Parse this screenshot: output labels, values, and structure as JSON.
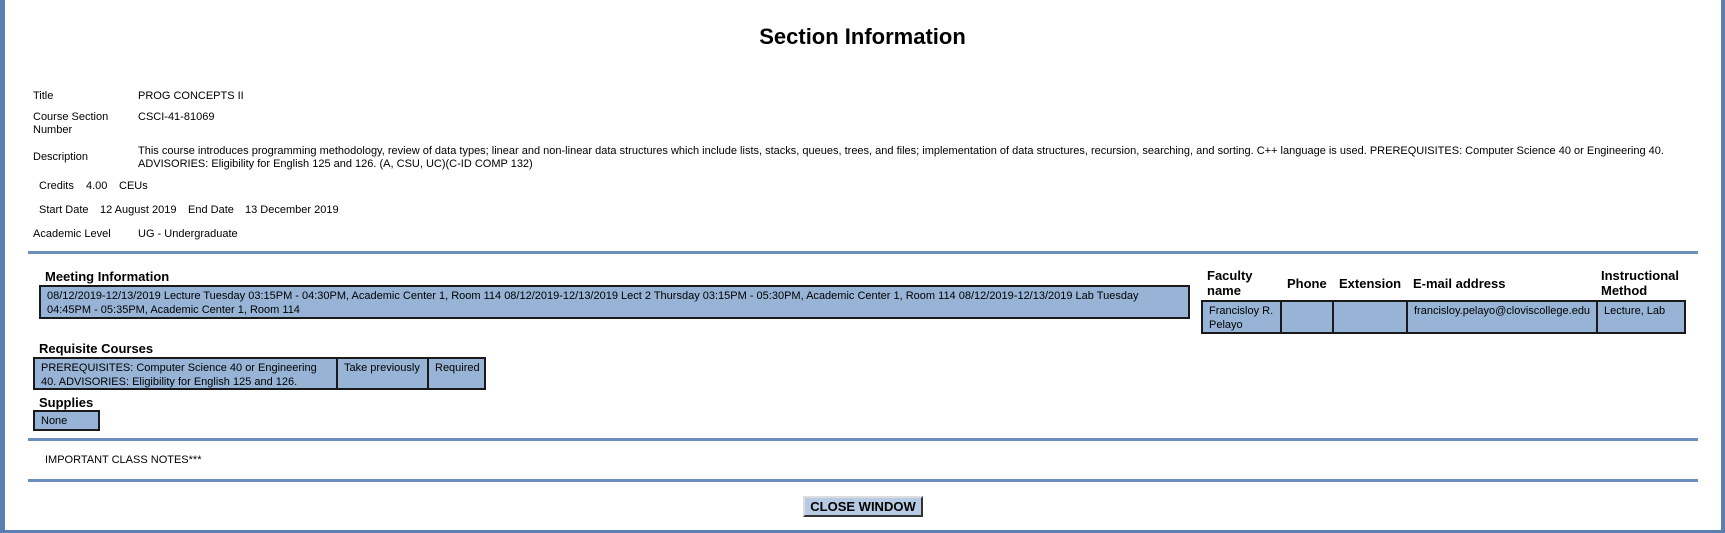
{
  "page_title": "Section Information",
  "fields": {
    "title_label": "Title",
    "title_value": "PROG CONCEPTS II",
    "course_section_label_1": "Course Section",
    "course_section_label_2": "Number",
    "course_section_value": "CSCI-41-81069",
    "description_label": "Description",
    "description_value": "This course introduces programming methodology, review of data types; linear and non-linear data structures which include lists, stacks, queues, trees, and files; implementation of data structures, recursion, searching, and sorting. C++ language is used. PREREQUISITES: Computer Science 40 or Engineering 40. ADVISORIES: Eligibility for English 125 and 126. (A, CSU, UC)(C-ID COMP 132)",
    "credits_label": "Credits",
    "credits_value": "4.00",
    "ceus_label": "CEUs",
    "start_date_label": "Start Date",
    "start_date_value": "12 August 2019",
    "end_date_label": "End Date",
    "end_date_value": "13 December 2019",
    "academic_level_label": "Academic Level",
    "academic_level_value": "UG - Undergraduate"
  },
  "meeting": {
    "heading": "Meeting Information",
    "text": "08/12/2019-12/13/2019 Lecture Tuesday 03:15PM - 04:30PM, Academic Center 1, Room 114 08/12/2019-12/13/2019 Lect 2 Thursday 03:15PM - 05:30PM, Academic Center 1, Room 114 08/12/2019-12/13/2019 Lab Tuesday 04:45PM - 05:35PM, Academic Center 1, Room 114"
  },
  "faculty": {
    "headers": {
      "name_1": "Faculty",
      "name_2": "name",
      "phone": "Phone",
      "extension": "Extension",
      "email": "E-mail address",
      "method_1": "Instructional",
      "method_2": "Method"
    },
    "row": {
      "name": "Francisloy R. Pelayo",
      "phone": "",
      "extension": "",
      "email": "francisloy.pelayo@cloviscollege.edu",
      "method": "Lecture, Lab"
    }
  },
  "requisites": {
    "heading": "Requisite Courses",
    "text": "PREREQUISITES: Computer Science 40 or Engineering 40. ADVISORIES: Eligibility for English 125 and 126.",
    "timing": "Take previously",
    "status": "Required"
  },
  "supplies": {
    "heading": "Supplies",
    "value": "None"
  },
  "notes": "IMPORTANT CLASS NOTES***",
  "close_button": "CLOSE WINDOW",
  "colors": {
    "cell_bg": "#97b4d6",
    "rule": "#6d8fbd",
    "frame": "#5b7fb0"
  }
}
